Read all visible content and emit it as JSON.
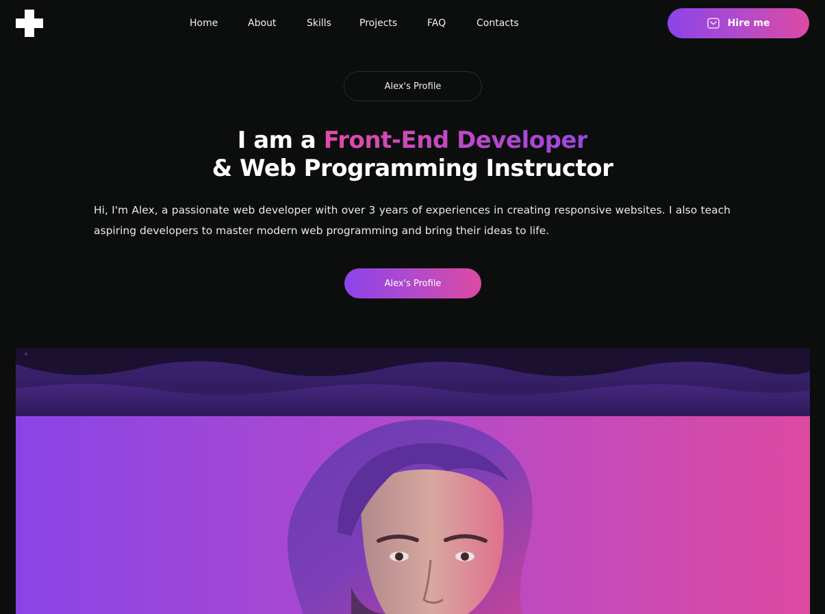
{
  "header": {
    "logo_icon": "plus-cross-logo",
    "nav": [
      "Home",
      "About",
      "Skills",
      "Projects",
      "FAQ",
      "Contacts"
    ],
    "hire_button": {
      "label": "Hire me",
      "icon": "mail-icon"
    }
  },
  "hero": {
    "profile_pill": "Alex's Profile",
    "headline_prefix": "I am a ",
    "headline_highlight": "Front-End Developer",
    "headline_line2": "& Web Programming Instructor",
    "intro": "Hi, I'm Alex, a passionate web developer with over 3 years of experiences in creating responsive websites. I also teach aspiring developers to master modern web programming and bring their ideas to life.",
    "cta_label": "Alex's Profile"
  },
  "colors": {
    "background": "#0c0d0d",
    "gradient_start": "#8b44e8",
    "gradient_end": "#dc4aa3",
    "wave_dark": "#1b1030"
  }
}
